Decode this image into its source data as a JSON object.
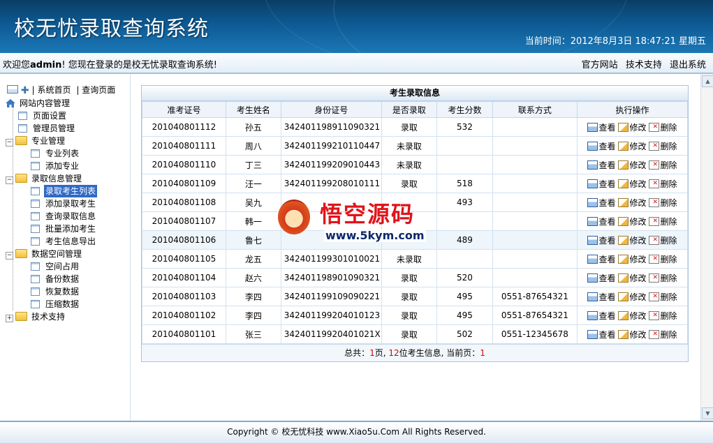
{
  "header": {
    "title": "校无忧录取查询系统",
    "clock_prefix": "当前时间：",
    "clock_value": "2012年8月3日  18:47:21 星期五"
  },
  "welcome": {
    "prefix": "欢迎您",
    "user": "admin",
    "suffix": "! 您现在登录的是校无忧录取查询系统!"
  },
  "top_links": [
    "官方网站",
    "技术支持",
    "退出系统"
  ],
  "sidebar": {
    "quick_links": [
      "| 系统首页",
      "| 查询页面"
    ],
    "tree": [
      {
        "label": "网站内容管理",
        "type": "root"
      },
      {
        "label": "页面设置",
        "type": "page",
        "level": 1
      },
      {
        "label": "管理员管理",
        "type": "page",
        "level": 1
      },
      {
        "label": "专业管理",
        "type": "folder",
        "level": 0
      },
      {
        "label": "专业列表",
        "type": "page",
        "level": 2
      },
      {
        "label": "添加专业",
        "type": "page",
        "level": 2
      },
      {
        "label": "录取信息管理",
        "type": "folder",
        "level": 0
      },
      {
        "label": "录取考生列表",
        "type": "page",
        "level": 2,
        "selected": true
      },
      {
        "label": "添加录取考生",
        "type": "page",
        "level": 2
      },
      {
        "label": "查询录取信息",
        "type": "page",
        "level": 2
      },
      {
        "label": "批量添加考生",
        "type": "page",
        "level": 2
      },
      {
        "label": "考生信息导出",
        "type": "page",
        "level": 2
      },
      {
        "label": "数据空间管理",
        "type": "folder",
        "level": 0
      },
      {
        "label": "空间占用",
        "type": "page",
        "level": 2
      },
      {
        "label": "备份数据",
        "type": "page",
        "level": 2
      },
      {
        "label": "恢复数据",
        "type": "page",
        "level": 2
      },
      {
        "label": "压缩数据",
        "type": "page",
        "level": 2
      },
      {
        "label": "技术支持",
        "type": "folder-collapsed",
        "level": 0
      }
    ]
  },
  "panel": {
    "title": "考生录取信息",
    "columns": [
      "准考证号",
      "考生姓名",
      "身份证号",
      "是否录取",
      "考生分数",
      "联系方式",
      "执行操作"
    ],
    "actions": [
      "查看",
      "修改",
      "删除"
    ],
    "rows": [
      [
        "201040801112",
        "孙五",
        "342401198911090321",
        "录取",
        "532",
        ""
      ],
      [
        "201040801111",
        "周八",
        "342401199210110447",
        "未录取",
        "",
        ""
      ],
      [
        "201040801110",
        "丁三",
        "342401199209010443",
        "未录取",
        "",
        ""
      ],
      [
        "201040801109",
        "汪一",
        "342401199208010111",
        "录取",
        "518",
        ""
      ],
      [
        "201040801108",
        "吴九",
        "",
        "",
        "493",
        ""
      ],
      [
        "201040801107",
        "韩一",
        "",
        "",
        "",
        ""
      ],
      [
        "201040801106",
        "鲁七",
        "",
        "",
        "489",
        ""
      ],
      [
        "201040801105",
        "龙五",
        "342401199301010021",
        "未录取",
        "",
        ""
      ],
      [
        "201040801104",
        "赵六",
        "342401198901090321",
        "录取",
        "520",
        ""
      ],
      [
        "201040801103",
        "李四",
        "342401199109090221",
        "录取",
        "495",
        "0551-87654321"
      ],
      [
        "201040801102",
        "李四",
        "342401199204010123",
        "录取",
        "495",
        "0551-87654321"
      ],
      [
        "201040801101",
        "张三",
        "34240119920401021X",
        "录取",
        "502",
        "0551-12345678"
      ]
    ],
    "highlight_row_index": 6,
    "summary": {
      "p1": "总共：",
      "pages": "1",
      "p2": "页, ",
      "count": "12",
      "p3": "位考生信息, 当前页：",
      "current": "1"
    }
  },
  "watermark": {
    "text": "悟空源码",
    "url": "www.5kym.com"
  },
  "footer": {
    "text": "Copyright © 校无忧科技  www.Xiao5u.Com All Rights Reserved."
  }
}
